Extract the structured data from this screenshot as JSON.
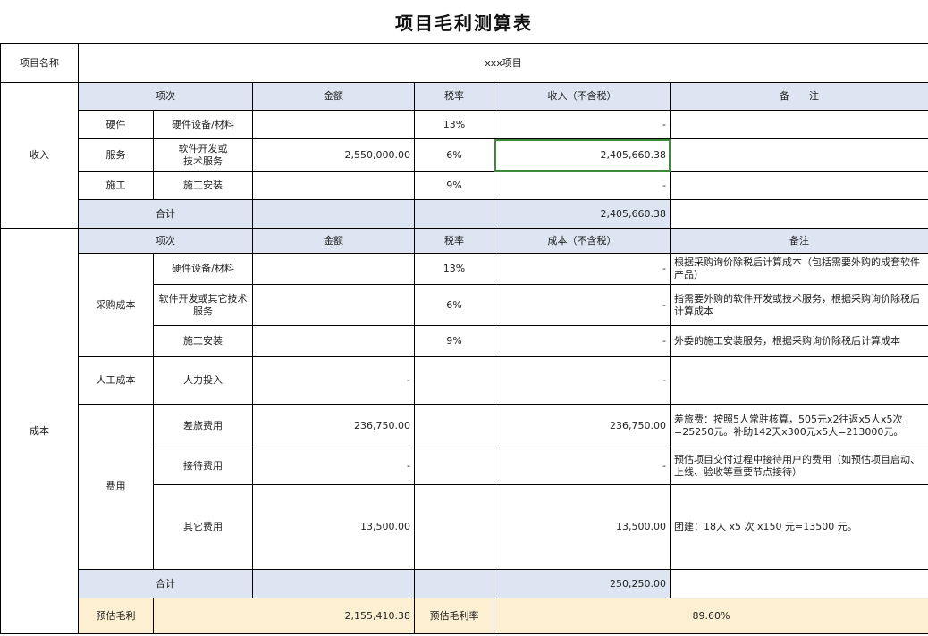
{
  "title": "项目毛利测算表",
  "project": {
    "label": "项目名称",
    "value": "xxx项目"
  },
  "income": {
    "section_label": "收入",
    "headers": {
      "item": "项次",
      "amount": "金额",
      "tax_rate": "税率",
      "revenue": "收入（不含税）",
      "note": "备　　注"
    },
    "rows": [
      {
        "category": "硬件",
        "item": "硬件设备/材料",
        "amount": "",
        "tax_rate": "13%",
        "revenue": "-",
        "note": ""
      },
      {
        "category": "服务",
        "item": "软件开发或\n技术服务",
        "amount": "2,550,000.00",
        "tax_rate": "6%",
        "revenue": "2,405,660.38",
        "note": ""
      },
      {
        "category": "施工",
        "item": "施工安装",
        "amount": "",
        "tax_rate": "9%",
        "revenue": "-",
        "note": ""
      }
    ],
    "total": {
      "label": "合计",
      "revenue": "2,405,660.38"
    }
  },
  "cost": {
    "section_label": "成本",
    "headers": {
      "item": "项次",
      "amount": "金额",
      "tax_rate": "税率",
      "cost": "成本（不含税）",
      "note": "备注"
    },
    "groups": [
      {
        "category": "采购成本",
        "rows": [
          {
            "item": "硬件设备/材料",
            "amount": "",
            "tax_rate": "13%",
            "cost": "-",
            "note": "根据采购询价除税后计算成本（包括需要外购的成套软件产品）"
          },
          {
            "item": "软件开发或其它技术服务",
            "amount": "",
            "tax_rate": "6%",
            "cost": "-",
            "note": "指需要外购的软件开发或技术服务，根据采购询价除税后计算成本"
          },
          {
            "item": "施工安装",
            "amount": "",
            "tax_rate": "9%",
            "cost": "-",
            "note": "外委的施工安装服务，根据采购询价除税后计算成本"
          }
        ]
      },
      {
        "category": "人工成本",
        "rows": [
          {
            "item": "人力投入",
            "amount": "-",
            "tax_rate": "",
            "cost": "-",
            "note": ""
          }
        ]
      },
      {
        "category": "费用",
        "rows": [
          {
            "item": "差旅费用",
            "amount": "236,750.00",
            "tax_rate": "",
            "cost": "236,750.00",
            "note": "差旅费：按照5人常驻核算，505元x2往返x5人x5次=25250元。补助142天x300元x5人=213000元。"
          },
          {
            "item": "接待费用",
            "amount": "-",
            "tax_rate": "",
            "cost": "-",
            "note": "预估项目交付过程中接待用户的费用（如预估项目启动、上线、验收等重要节点接待）"
          },
          {
            "item": "其它费用",
            "amount": "13,500.00",
            "tax_rate": "",
            "cost": "13,500.00",
            "note": "团建：18人 x5 次 x150 元=13500 元。"
          }
        ]
      }
    ],
    "total": {
      "label": "合计",
      "cost": "250,250.00"
    }
  },
  "summary": {
    "gross_profit_label": "预估毛利",
    "gross_profit_value": "2,155,410.38",
    "margin_label": "预估毛利率",
    "margin_value": "89.60%"
  },
  "colors": {
    "header_fill": "#dce5f1",
    "summary_fill": "#fdf0d2",
    "selection_border": "#3c8b3a"
  }
}
